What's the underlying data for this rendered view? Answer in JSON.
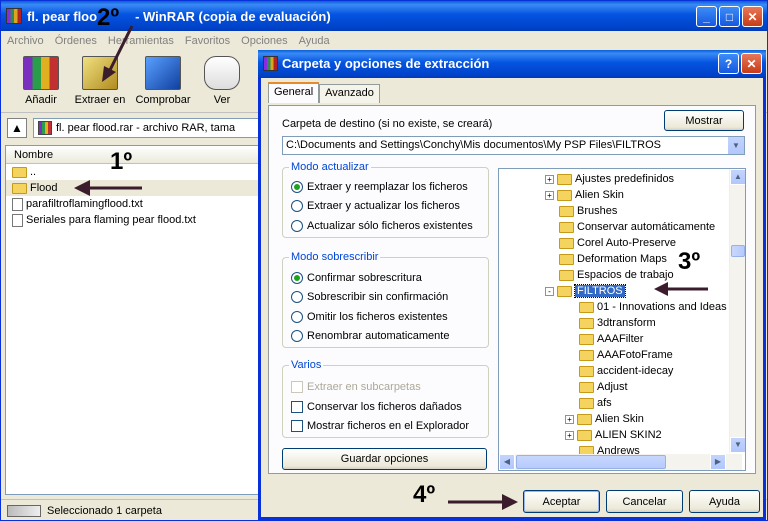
{
  "main_window": {
    "title": "fl. pear flood.rar - WinRAR (copia de evaluación)",
    "title_visible": "fl. pear floo",
    "title_rest": "- WinRAR (copia de evaluación)",
    "menu": [
      "Archivo",
      "Órdenes",
      "Herramientas",
      "Favoritos",
      "Opciones",
      "Ayuda"
    ],
    "toolbar": [
      {
        "label": "Añadir",
        "icon": "add-archive-icon"
      },
      {
        "label": "Extraer en",
        "icon": "extract-to-icon"
      },
      {
        "label": "Comprobar",
        "icon": "test-archive-icon"
      },
      {
        "label": "Ver",
        "icon": "view-icon"
      }
    ],
    "path": "fl. pear flood.rar - archivo RAR, tama",
    "list_header": "Nombre",
    "files": [
      {
        "name": "..",
        "type": "folder"
      },
      {
        "name": "Flood",
        "type": "folder"
      },
      {
        "name": "parafiltroflamingflood.txt",
        "type": "text"
      },
      {
        "name": "Seriales para flaming pear flood.txt",
        "type": "text"
      }
    ],
    "status": "Seleccionado 1 carpeta"
  },
  "dialog": {
    "title": "Carpeta y opciones de extracción",
    "tabs": [
      "General",
      "Avanzado"
    ],
    "dest_label": "Carpeta de destino (si no existe, se creará)",
    "dest_value": "C:\\Documents and Settings\\Conchy\\Mis documentos\\My PSP Files\\FILTROS",
    "show_button": "Mostrar",
    "update_group": {
      "title": "Modo actualizar",
      "options": [
        {
          "label": "Extraer y reemplazar los ficheros",
          "checked": true
        },
        {
          "label": "Extraer y actualizar los ficheros",
          "checked": false
        },
        {
          "label": "Actualizar sólo ficheros existentes",
          "checked": false
        }
      ]
    },
    "overwrite_group": {
      "title": "Modo sobrescribir",
      "options": [
        {
          "label": "Confirmar sobrescritura",
          "checked": true
        },
        {
          "label": "Sobrescribir sin confirmación",
          "checked": false
        },
        {
          "label": "Omitir los ficheros existentes",
          "checked": false
        },
        {
          "label": "Renombrar automaticamente",
          "checked": false
        }
      ]
    },
    "misc_group": {
      "title": "Varios",
      "options": [
        {
          "label": "Extraer en subcarpetas",
          "checked": false,
          "disabled": true
        },
        {
          "label": "Conservar los ficheros dañados",
          "checked": false,
          "disabled": false
        },
        {
          "label": "Mostrar ficheros en el Explorador",
          "checked": false,
          "disabled": false
        }
      ]
    },
    "save_button": "Guardar opciones",
    "tree": [
      {
        "label": "Ajustes predefinidos",
        "level": 0,
        "expander": "+"
      },
      {
        "label": "Alien Skin",
        "level": 0,
        "expander": "+"
      },
      {
        "label": "Brushes",
        "level": 0,
        "expander": ""
      },
      {
        "label": "Conservar automáticamente",
        "level": 0,
        "expander": ""
      },
      {
        "label": "Corel Auto-Preserve",
        "level": 0,
        "expander": ""
      },
      {
        "label": "Deformation Maps",
        "level": 0,
        "expander": ""
      },
      {
        "label": "Espacios de trabajo",
        "level": 0,
        "expander": ""
      },
      {
        "label": "FILTROS",
        "level": 0,
        "expander": "-",
        "selected": true
      },
      {
        "label": "01 - Innovations and Ideas",
        "level": 1,
        "expander": ""
      },
      {
        "label": "3dtransform",
        "level": 1,
        "expander": ""
      },
      {
        "label": "AAAFilter",
        "level": 1,
        "expander": ""
      },
      {
        "label": "AAAFotoFrame",
        "level": 1,
        "expander": ""
      },
      {
        "label": "accident-idecay",
        "level": 1,
        "expander": ""
      },
      {
        "label": "Adjust",
        "level": 1,
        "expander": ""
      },
      {
        "label": "afs",
        "level": 1,
        "expander": ""
      },
      {
        "label": "Alien Skin",
        "level": 1,
        "expander": "+"
      },
      {
        "label": "ALIEN SKIN2",
        "level": 1,
        "expander": "+"
      },
      {
        "label": "Andrews",
        "level": 1,
        "expander": ""
      }
    ],
    "buttons": {
      "accept": "Aceptar",
      "cancel": "Cancelar",
      "help": "Ayuda"
    }
  },
  "annotations": [
    "1º",
    "2º",
    "3º",
    "4º"
  ]
}
